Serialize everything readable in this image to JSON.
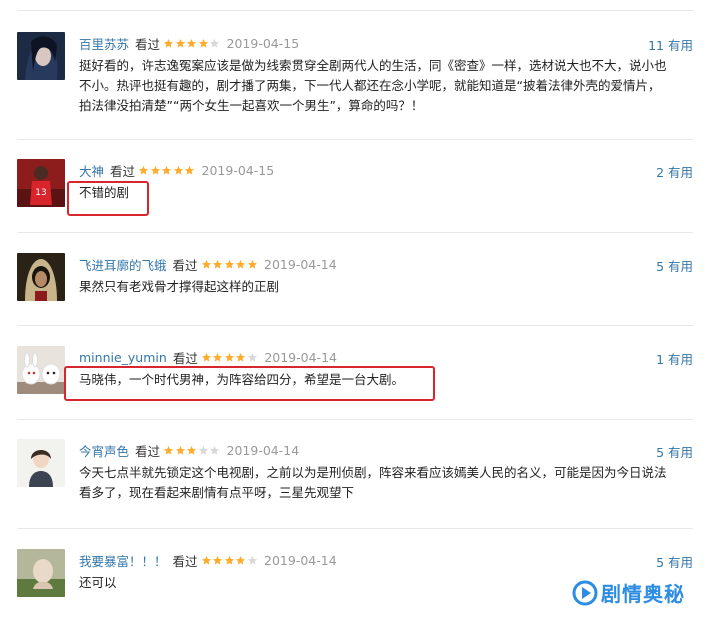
{
  "comments": [
    {
      "user": "百里苏苏",
      "status": "看过",
      "rating": 4,
      "date": "2019-04-15",
      "useful": "11 有用",
      "lines": [
        "挺好看的，许志逸冤案应该是做为线索贯穿全剧两代人的生活，同《密查》一样，选材说大也不大，说小也",
        "不小。热评也挺有趣的，剧才播了两集，下一代人都还在念小学呢，就能知道是“披着法律外壳的爱情片，",
        "拍法律没拍清楚”“两个女生一起喜欢一个男生”，算命的吗？！"
      ]
    },
    {
      "user": "大神",
      "status": "看过",
      "rating": 5,
      "date": "2019-04-15",
      "useful": "2 有用",
      "lines": [
        "不错的剧"
      ]
    },
    {
      "user": "飞进耳廓的飞蛾",
      "status": "看过",
      "rating": 5,
      "date": "2019-04-14",
      "useful": "5 有用",
      "lines": [
        "果然只有老戏骨才撑得起这样的正剧"
      ]
    },
    {
      "user": "minnie_yumin",
      "status": "看过",
      "rating": 4,
      "date": "2019-04-14",
      "useful": "1 有用",
      "lines": [
        "马晓伟，一个时代男神，为阵容给四分，希望是一台大剧。"
      ]
    },
    {
      "user": "今宵声色",
      "status": "看过",
      "rating": 3,
      "date": "2019-04-14",
      "useful": "5 有用",
      "lines": [
        "今天七点半就先锁定这个电视剧，之前以为是刑侦剧，阵容来看应该嫣美人民的名义，可能是因为今日说法",
        "看多了，现在看起来剧情有点平呀，三星先观望下"
      ]
    },
    {
      "user": "我要暴富！！！",
      "status": "看过",
      "rating": 4,
      "date": "2019-04-14",
      "useful": "5 有用",
      "lines": [
        "还可以"
      ]
    }
  ],
  "watermark": {
    "text": "剧情奥秘"
  },
  "colors": {
    "link": "#3377aa",
    "star": "#ffac2d",
    "star_empty": "#d8d8d8",
    "highlight": "#d7262d",
    "watermark": "#2d8de3"
  }
}
